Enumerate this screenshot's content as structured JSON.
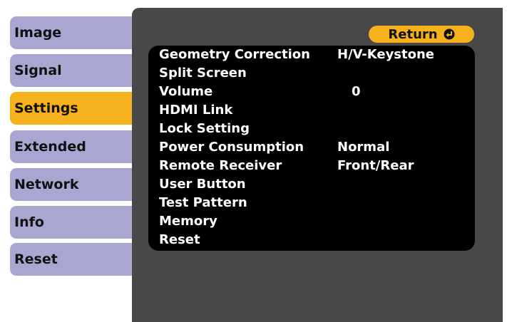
{
  "sidebar": {
    "items": [
      {
        "label": "Image"
      },
      {
        "label": "Signal"
      },
      {
        "label": "Settings"
      },
      {
        "label": "Extended"
      },
      {
        "label": "Network"
      },
      {
        "label": "Info"
      },
      {
        "label": "Reset"
      }
    ]
  },
  "return_label": "Return",
  "menu": {
    "rows": [
      {
        "label": "Geometry Correction",
        "value": "H/V-Keystone"
      },
      {
        "label": "Split Screen",
        "value": ""
      },
      {
        "label": "Volume",
        "value": "0"
      },
      {
        "label": "HDMI Link",
        "value": ""
      },
      {
        "label": "Lock Setting",
        "value": ""
      },
      {
        "label": "Power Consumption",
        "value": "Normal"
      },
      {
        "label": "Remote Receiver",
        "value": "Front/Rear"
      },
      {
        "label": "User Button",
        "value": ""
      },
      {
        "label": "Test Pattern",
        "value": ""
      },
      {
        "label": "Memory",
        "value": ""
      },
      {
        "label": "Reset",
        "value": ""
      }
    ]
  },
  "colors": {
    "tab": "#a9a6d2",
    "active_tab": "#f5b21d",
    "panel": "#484848",
    "list": "#000000",
    "text": "#ffffff"
  },
  "icons": {
    "enter": "enter-icon"
  }
}
